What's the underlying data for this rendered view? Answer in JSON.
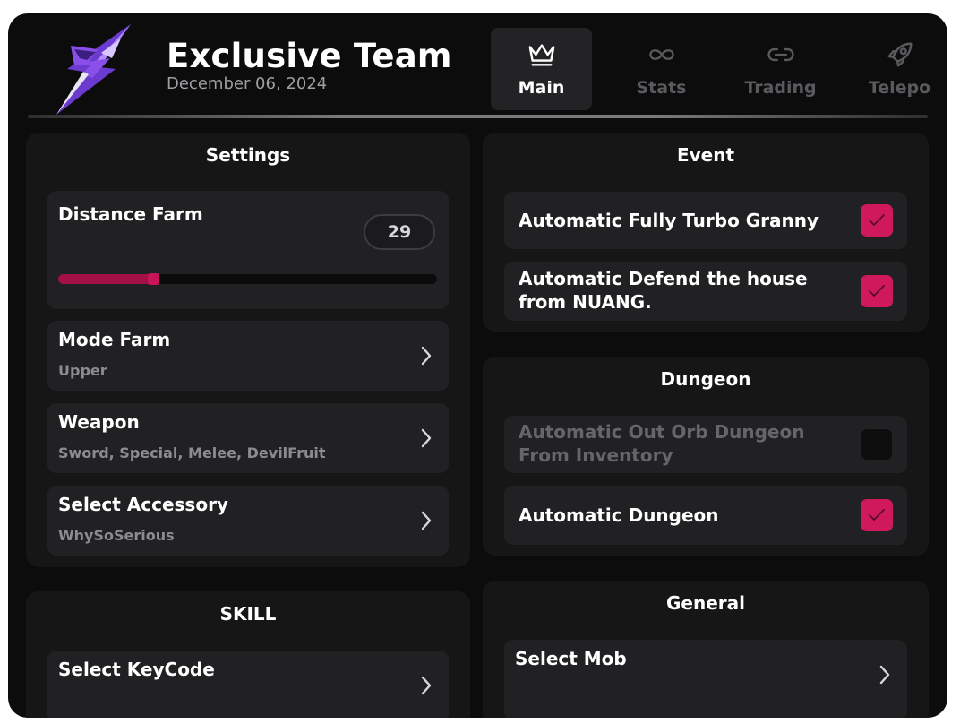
{
  "header": {
    "title": "Exclusive Team",
    "date": "December 06, 2024",
    "logo_icon": "purple-star-logo"
  },
  "tabs": [
    {
      "label": "Main",
      "icon": "crown-icon",
      "active": true
    },
    {
      "label": "Stats",
      "icon": "infinity-icon",
      "active": false
    },
    {
      "label": "Trading",
      "icon": "link-icon",
      "active": false
    },
    {
      "label": "Telepo",
      "icon": "rocket-icon",
      "active": false
    }
  ],
  "settings": {
    "title": "Settings",
    "distance_farm": {
      "label": "Distance Farm",
      "value": "29",
      "fill_fraction": 0.25
    },
    "mode_farm": {
      "label": "Mode Farm",
      "value": "Upper"
    },
    "weapon": {
      "label": "Weapon",
      "value": "Sword, Special, Melee, DevilFruit"
    },
    "accessory": {
      "label": "Select Accessory",
      "value": "WhySoSerious"
    }
  },
  "skill": {
    "title": "SKILL",
    "keycode": {
      "label": "Select KeyCode"
    }
  },
  "event": {
    "title": "Event",
    "items": [
      {
        "line1": "Automatic Fully Turbo Granny",
        "line2": "",
        "checked": true,
        "disabled": false
      },
      {
        "line1": "Automatic Defend the house",
        "line2": "from NUANG.",
        "checked": true,
        "disabled": false
      }
    ]
  },
  "dungeon": {
    "title": "Dungeon",
    "items": [
      {
        "line1": "Automatic Out Orb Dungeon",
        "line2": "From Inventory",
        "checked": false,
        "disabled": true
      },
      {
        "line1": "Automatic Dungeon",
        "line2": "",
        "checked": true,
        "disabled": false
      }
    ]
  },
  "general": {
    "title": "General",
    "select_mob": {
      "label": "Select Mob"
    }
  },
  "colors": {
    "accent": "#d0195c",
    "slider_fill": "#a21046",
    "background": "#0c0c0d",
    "panel": "#161617",
    "card": "#212123"
  }
}
